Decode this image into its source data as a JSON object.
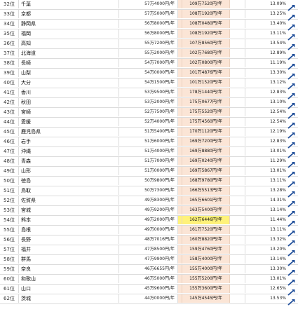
{
  "colors": {
    "unit_fill": "#fbe5d6",
    "unit_highlight": "#fff27a",
    "arrow_blue": "#1f4e9a"
  },
  "rows": [
    {
      "rank": "32位",
      "name": "千葉",
      "total": "57万4000円/年",
      "unit": "109万7520円/年",
      "pct": "13.09%",
      "icon": "blue-arrow-icon"
    },
    {
      "rank": "33位",
      "name": "京都",
      "total": "57万5000円/年",
      "unit": "108万1920円/年",
      "pct": "13.25%",
      "icon": "blue-arrow-icon"
    },
    {
      "rank": "34位",
      "name": "静岡県",
      "total": "56万8000円/年",
      "unit": "108万0480円/年",
      "pct": "13.40%",
      "icon": "blue-arrow-icon"
    },
    {
      "rank": "35位",
      "name": "福岡",
      "total": "56万8000円/年",
      "unit": "108万1920円/年",
      "pct": "13.11%",
      "icon": "blue-arrow-icon"
    },
    {
      "rank": "36位",
      "name": "高知",
      "total": "55万7200円/年",
      "unit": "107万8560円/年",
      "pct": "13.54%",
      "icon": "blue-arrow-icon"
    },
    {
      "rank": "37位",
      "name": "北海道",
      "total": "55万2000円/年",
      "unit": "102万7680円/年",
      "pct": "12.89%",
      "icon": "blue-arrow-icon"
    },
    {
      "rank": "38位",
      "name": "長崎",
      "total": "54万7000円/年",
      "unit": "102万0800円/年",
      "pct": "11.19%",
      "icon": "blue-arrow-icon"
    },
    {
      "rank": "39位",
      "name": "山梨",
      "total": "54万0000円/年",
      "unit": "101万4876円/年",
      "pct": "13.30%",
      "icon": "blue-arrow-icon"
    },
    {
      "rank": "40位",
      "name": "大分",
      "total": "54万1500円/年",
      "unit": "101万1520円/年",
      "pct": "13.12%",
      "icon": "blue-arrow-icon"
    },
    {
      "rank": "41位",
      "name": "香川",
      "total": "53万9500円/年",
      "unit": "178万1440円/年",
      "pct": "12.83%",
      "icon": "blue-arrow-icon"
    },
    {
      "rank": "42位",
      "name": "秋田",
      "total": "53万2000円/年",
      "unit": "175万0677円/年",
      "pct": "13.10%",
      "icon": "blue-arrow-icon"
    },
    {
      "rank": "43位",
      "name": "宮崎",
      "total": "52万7500円/年",
      "unit": "175万5520円/年",
      "pct": "12.54%",
      "icon": "blue-arrow-icon"
    },
    {
      "rank": "44位",
      "name": "愛媛",
      "total": "52万4000円/年",
      "unit": "175万4560円/年",
      "pct": "12.54%",
      "icon": "blue-arrow-icon"
    },
    {
      "rank": "45位",
      "name": "鹿児島県",
      "total": "51万5400円/年",
      "unit": "170万1120円/年",
      "pct": "12.19%",
      "icon": "blue-arrow-icon"
    },
    {
      "rank": "46位",
      "name": "岩手",
      "total": "51万6000円/年",
      "unit": "169万7200円/年",
      "pct": "12.83%",
      "icon": "blue-arrow-icon"
    },
    {
      "rank": "47位",
      "name": "沖縄",
      "total": "51万4000円/年",
      "unit": "169万8880円/年",
      "pct": "13.01%",
      "icon": "blue-arrow-icon"
    },
    {
      "rank": "48位",
      "name": "青森",
      "total": "51万7000円/年",
      "unit": "169万0240円/年",
      "pct": "11.29%",
      "icon": "blue-arrow-icon"
    },
    {
      "rank": "49位",
      "name": "山形",
      "total": "51万0000円/年",
      "unit": "169万5867円/年",
      "pct": "13.01%",
      "icon": "blue-arrow-icon"
    },
    {
      "rank": "50位",
      "name": "徳島",
      "total": "50万9800円/年",
      "unit": "168万9780円/年",
      "pct": "13.11%",
      "icon": "blue-arrow-icon"
    },
    {
      "rank": "51位",
      "name": "鳥取",
      "total": "50万7300円/年",
      "unit": "166万5513円/年",
      "pct": "13.28%",
      "icon": "blue-arrow-icon"
    },
    {
      "rank": "52位",
      "name": "佐賀県",
      "total": "49万8300円/年",
      "unit": "165万6601円/年",
      "pct": "14.31%",
      "icon": "blue-arrow-icon"
    },
    {
      "rank": "53位",
      "name": "宮城",
      "total": "49万9200円/年",
      "unit": "163万5400円/年",
      "pct": "13.14%",
      "icon": "blue-arrow-icon"
    },
    {
      "rank": "54位",
      "name": "熊本",
      "total": "49万2000円/年",
      "unit": "162万6446円/年",
      "pct": "11.44%",
      "icon": "blue-arrow-icon",
      "highlight": true
    },
    {
      "rank": "55位",
      "name": "島根",
      "total": "49万0000円/年",
      "unit": "161万7520円/年",
      "pct": "13.11%",
      "icon": "blue-arrow-icon"
    },
    {
      "rank": "56位",
      "name": "長野",
      "total": "48万7016円/年",
      "unit": "160万8820円/年",
      "pct": "13.32%",
      "icon": "blue-arrow-icon"
    },
    {
      "rank": "57位",
      "name": "福井",
      "total": "47万8500円/年",
      "unit": "159万4760円/年",
      "pct": "13.20%",
      "icon": "blue-arrow-icon"
    },
    {
      "rank": "58位",
      "name": "群馬",
      "total": "47万9900円/年",
      "unit": "158万4000円/年",
      "pct": "13.14%",
      "icon": "blue-arrow-icon"
    },
    {
      "rank": "59位",
      "name": "奈良",
      "total": "46万6655円/年",
      "unit": "155万4000円/年",
      "pct": "13.30%",
      "icon": "blue-arrow-icon"
    },
    {
      "rank": "60位",
      "name": "和歌山",
      "total": "46万5000円/年",
      "unit": "155万5200円/年",
      "pct": "13.01%",
      "icon": "blue-arrow-icon"
    },
    {
      "rank": "61位",
      "name": "山口",
      "total": "45万9600円/年",
      "unit": "155万3600円/年",
      "pct": "12.65%",
      "icon": "blue-arrow-icon"
    },
    {
      "rank": "62位",
      "name": "茨城",
      "total": "44万0000円/年",
      "unit": "145万4545円/年",
      "pct": "13.53%",
      "icon": "blue-arrow-icon"
    }
  ]
}
